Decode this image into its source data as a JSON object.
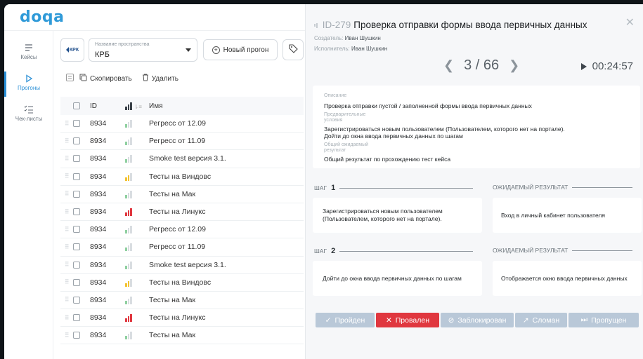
{
  "app": {
    "logo": "doqa"
  },
  "nav": {
    "items": [
      {
        "label": "Кейсы",
        "icon": "list-icon"
      },
      {
        "label": "Прогоны",
        "icon": "play-icon",
        "active": true
      },
      {
        "label": "Чек-листы",
        "icon": "checklist-icon"
      }
    ]
  },
  "toolbar": {
    "space_badge": "КРК",
    "space_label": "Название пространства",
    "space_value": "КРБ",
    "new_run_label": "Новый прогон",
    "copy_label": "Скопировать",
    "delete_label": "Удалить"
  },
  "table": {
    "headers": {
      "id": "ID",
      "name": "Имя"
    },
    "rows": [
      {
        "id": "8934",
        "priority": 1,
        "name": "Регресс от 12.09"
      },
      {
        "id": "8934",
        "priority": 1,
        "name": "Регресс от 11.09"
      },
      {
        "id": "8934",
        "priority": 1,
        "name": "Smoke test версия 3.1."
      },
      {
        "id": "8934",
        "priority": 2,
        "name": "Тесты на Виндовс"
      },
      {
        "id": "8934",
        "priority": 1,
        "name": "Тесты на Мак"
      },
      {
        "id": "8934",
        "priority": 3,
        "name": "Тесты на Линукс"
      },
      {
        "id": "8934",
        "priority": 1,
        "name": "Регресс от 12.09"
      },
      {
        "id": "8934",
        "priority": 1,
        "name": "Регресс от 11.09"
      },
      {
        "id": "8934",
        "priority": 1,
        "name": "Smoke test версия 3.1."
      },
      {
        "id": "8934",
        "priority": 2,
        "name": "Тесты на Виндовс"
      },
      {
        "id": "8934",
        "priority": 1,
        "name": "Тесты на Мак"
      },
      {
        "id": "8934",
        "priority": 3,
        "name": "Тесты на Линукс"
      },
      {
        "id": "8934",
        "priority": 1,
        "name": "Тесты на Мак"
      }
    ],
    "priority_colors": {
      "1": "#8fd0a0",
      "2": "#f2c230",
      "3": "#e0373f"
    }
  },
  "panel": {
    "test_id": "ID-279",
    "title": "Проверка отправки формы ввода первичных данных",
    "creator_label": "Создатель:",
    "creator": "Иван Шушкин",
    "assignee_label": "Исполнитель:",
    "assignee": "Иван Шушкин",
    "pager": "3 / 66",
    "timer": "00:24:57",
    "description_label": "Описание",
    "description": "Проверка отправки пустой / заполненной формы ввода первичных данных",
    "preconditions_label_1": "Предварительные",
    "preconditions_label_2": "условия",
    "preconditions_1": "Зарегистрироваться новым пользователем (Пользователем, которого нет на портале).",
    "preconditions_2": "Дойти до окна ввода первичных данных по шагам",
    "expected_label_1": "Общий ожидаемый",
    "expected_label_2": "результат",
    "expected": "Общий результат по прохождению тест кейса",
    "step_label": "ШАГ",
    "expected_result_label": "ОЖИДАЕМЫЙ РЕЗУЛЬТАТ",
    "steps": [
      {
        "num": "1",
        "action": "Зарегистрироваться новым пользователем (Пользователем, которого нет на портале).",
        "result": "Вход в личный кабинет пользователя"
      },
      {
        "num": "2",
        "action": "Дойти до окна ввода первичных данных по шагам",
        "result": "Отображается окно ввода первичных данных"
      }
    ],
    "statuses": [
      {
        "label": "Пройден",
        "icon": "✓"
      },
      {
        "label": "Провален",
        "icon": "✕"
      },
      {
        "label": "Заблокирован",
        "icon": "⊘"
      },
      {
        "label": "Сломан",
        "icon": "↗"
      },
      {
        "label": "Пропущен",
        "icon": "⏭"
      }
    ]
  }
}
